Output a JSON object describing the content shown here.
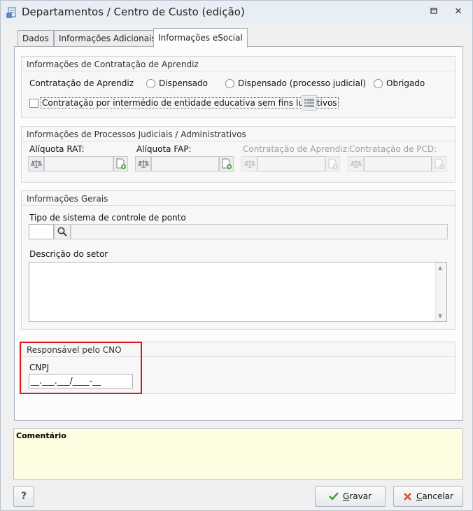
{
  "window": {
    "title": "Departamentos / Centro de Custo (edição)",
    "restore_icon": "restore-icon",
    "close_glyph": "✕"
  },
  "tabs": [
    {
      "label": "Dados",
      "active": false
    },
    {
      "label": "Informações Adicionais",
      "active": false
    },
    {
      "label": "Informações eSocial",
      "active": true
    }
  ],
  "aprendiz": {
    "title": "Informações de Contratação de Aprendiz",
    "field_label": "Contratação de Aprendiz",
    "options": [
      "Dispensado",
      "Dispensado (processo judicial)",
      "Obrigado"
    ],
    "checkbox_label": "Contratação por intermédio de entidade educativa sem fins lucrativos"
  },
  "processos": {
    "title": "Informações de Processos Judiciais / Administrativos",
    "fields": [
      {
        "label": "Alíquota RAT:",
        "enabled": true
      },
      {
        "label": "Alíquota FAP:",
        "enabled": true
      },
      {
        "label": "Contratação de Aprendiz:",
        "enabled": false
      },
      {
        "label": "Contratação de PCD:",
        "enabled": false
      }
    ]
  },
  "gerais": {
    "title": "Informações Gerais",
    "ponto_label": "Tipo de sistema de controle de ponto",
    "ponto_code": "",
    "ponto_desc": "",
    "descricao_label": "Descrição do setor",
    "descricao_value": ""
  },
  "cno": {
    "title": "Responsável pelo CNO",
    "cnpj_label": "CNPJ",
    "cnpj_mask": "__.___.___/____-__"
  },
  "comment": {
    "label": "Comentário",
    "value": ""
  },
  "buttons": {
    "help": "?",
    "save_prefix": "",
    "save_hotkey": "G",
    "save_rest": "ravar",
    "cancel_hotkey": "C",
    "cancel_rest": "ancelar"
  },
  "colors": {
    "highlight": "#e0181e",
    "comment_bg": "#fdfde2",
    "save_check": "#3a9a2f",
    "cancel_x": "#d9502a"
  }
}
